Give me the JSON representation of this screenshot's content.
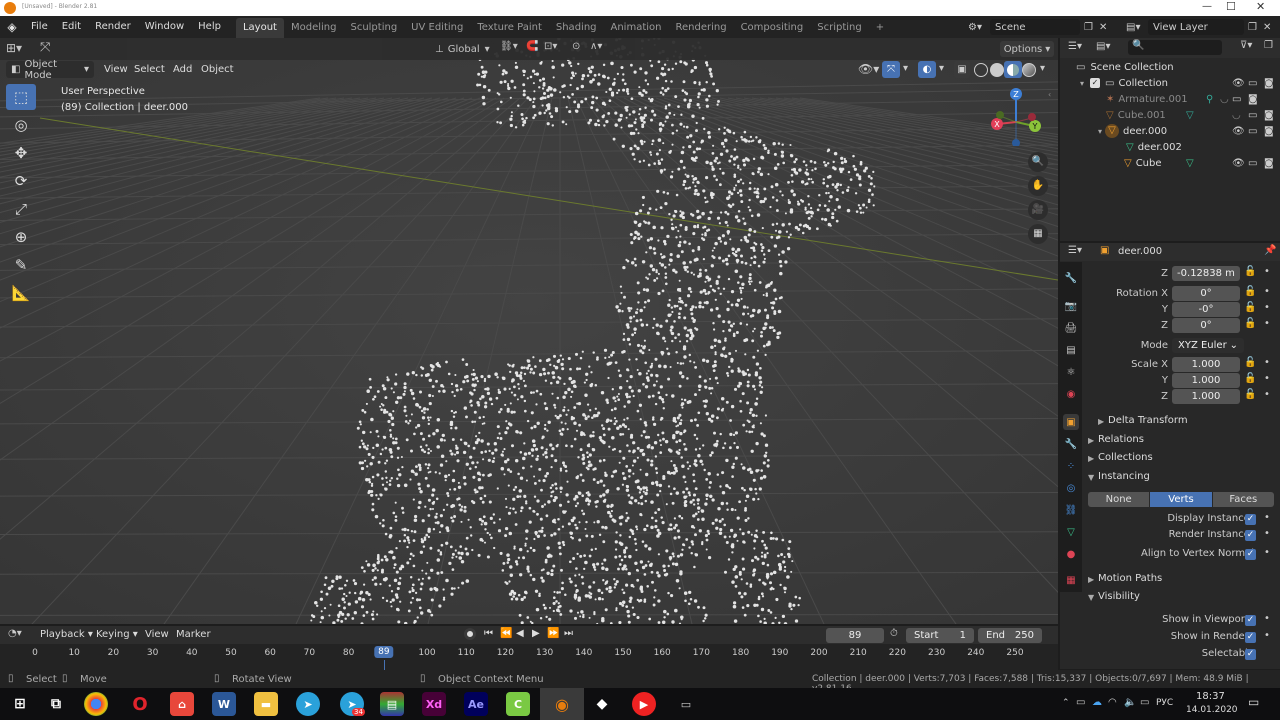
{
  "titlebar": {
    "title": "[Unsaved] - Blender 2.81"
  },
  "menubar": {
    "menus": [
      "File",
      "Edit",
      "Render",
      "Window",
      "Help"
    ],
    "workspaces": [
      "Layout",
      "Modeling",
      "Sculpting",
      "UV Editing",
      "Texture Paint",
      "Shading",
      "Animation",
      "Rendering",
      "Compositing",
      "Scripting"
    ],
    "active_workspace": "Layout",
    "scene": "Scene",
    "view_layer": "View Layer"
  },
  "viewport": {
    "transform_orientation": "Global",
    "options": "Options",
    "mode": "Object Mode",
    "menus": [
      "View",
      "Select",
      "Add",
      "Object"
    ],
    "perspective": "User Perspective",
    "info": "(89) Collection | deer.000",
    "gizmo": {
      "x": "X",
      "y": "Y",
      "z": "Z"
    }
  },
  "outliner": {
    "root": "Scene Collection",
    "rows": [
      {
        "label": "Collection"
      },
      {
        "label": "Armature.001"
      },
      {
        "label": "Cube.001"
      },
      {
        "label": "deer.000"
      },
      {
        "label": "deer.002"
      },
      {
        "label": "Cube"
      }
    ]
  },
  "properties": {
    "object_name": "deer.000",
    "loc_z_label": "Z",
    "loc_z": "-0.12838 m",
    "rotation_label": "Rotation X",
    "rotation": [
      "0°",
      "-0°",
      "0°"
    ],
    "y_label": "Y",
    "z_label": "Z",
    "mode_label": "Mode",
    "mode": "XYZ Euler",
    "scale_label": "Scale X",
    "scale": [
      "1.000",
      "1.000",
      "1.000"
    ],
    "delta_transform": "Delta Transform",
    "relations": "Relations",
    "collections": "Collections",
    "instancing": "Instancing",
    "instancing_options": [
      "None",
      "Verts",
      "Faces"
    ],
    "instancing_active": "Verts",
    "display_instancer": "Display Instancer",
    "render_instancer": "Render Instancer",
    "align_normal": "Align to Vertex Normal",
    "motion_paths": "Motion Paths",
    "visibility": "Visibility",
    "show_viewports": "Show in Viewports",
    "show_renders": "Show in Renders",
    "selectable": "Selectable"
  },
  "timeline": {
    "menus": [
      "Playback",
      "Keying",
      "View",
      "Marker"
    ],
    "current_frame": "89",
    "start_label": "Start",
    "start": "1",
    "end_label": "End",
    "end": "250",
    "ticks": [
      "0",
      "10",
      "20",
      "30",
      "40",
      "50",
      "60",
      "70",
      "80",
      "89",
      "100",
      "110",
      "120",
      "130",
      "140",
      "150",
      "160",
      "170",
      "180",
      "190",
      "200",
      "210",
      "220",
      "230",
      "240",
      "250"
    ]
  },
  "statusbar": {
    "select": "Select",
    "move": "Move",
    "rotate": "Rotate View",
    "context": "Object Context Menu",
    "stats": "Collection | deer.000 | Verts:7,703 | Faces:7,588 | Tris:15,337 | Objects:0/7,697 | Mem: 48.9 MiB | v2.81.16"
  },
  "taskbar": {
    "time": "18:37",
    "date": "14.01.2020",
    "lang": "РУС",
    "telegram_badge": "34",
    "apps": [
      "W",
      "Xd",
      "Ae"
    ]
  }
}
